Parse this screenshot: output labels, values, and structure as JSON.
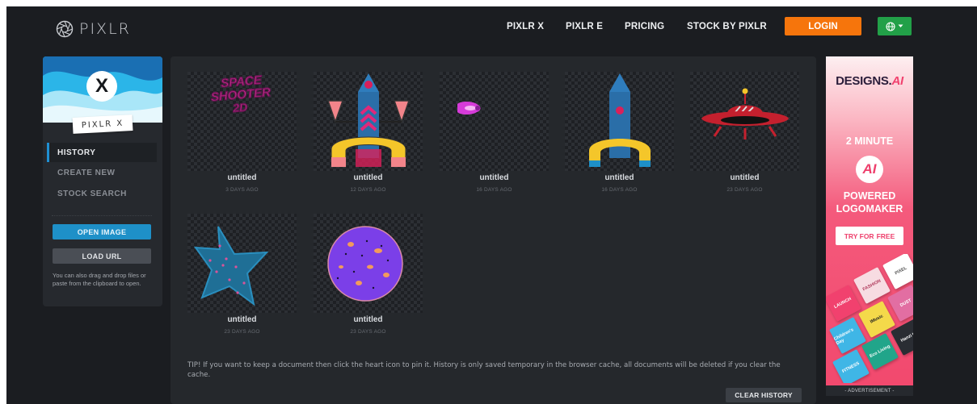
{
  "header": {
    "logo_text": "PIXLR",
    "nav": [
      "PIXLR X",
      "PIXLR E",
      "PRICING",
      "STOCK BY PIXLR"
    ],
    "login_label": "LOGIN",
    "language_icon": "globe-icon"
  },
  "sidebar": {
    "brand_letter": "X",
    "brand_label": "PIXLR X",
    "menu": [
      {
        "label": "HISTORY",
        "active": true
      },
      {
        "label": "CREATE NEW",
        "active": false
      },
      {
        "label": "STOCK SEARCH",
        "active": false
      }
    ],
    "open_image_label": "OPEN IMAGE",
    "load_url_label": "LOAD URL",
    "hint": "You can also drag and drop files or paste from the clipboard to open."
  },
  "history": {
    "items": [
      {
        "title": "untitled",
        "date": "3 DAYS AGO",
        "image": "space-shooter-title",
        "image_text": [
          "SPACE",
          "SHOOTER",
          "2D"
        ]
      },
      {
        "title": "untitled",
        "date": "12 DAYS AGO",
        "image": "rocket-with-side-cones"
      },
      {
        "title": "untitled",
        "date": "16 DAYS AGO",
        "image": "pink-bullet"
      },
      {
        "title": "untitled",
        "date": "16 DAYS AGO",
        "image": "rocket"
      },
      {
        "title": "untitled",
        "date": "23 DAYS AGO",
        "image": "ufo"
      },
      {
        "title": "untitled",
        "date": "23 DAYS AGO",
        "image": "blue-star"
      },
      {
        "title": "untitled",
        "date": "23 DAYS AGO",
        "image": "purple-planet"
      }
    ],
    "tip": "TIP! If you want to keep a document then click the heart icon to pin it. History is only saved temporary in the browser cache, all documents will be deleted if you clear the cache.",
    "clear_label": "CLEAR HISTORY"
  },
  "ad": {
    "brand": "DESIGNS.",
    "brand_accent": "AI",
    "line1": "2 MINUTE",
    "icon_letter": "AI",
    "line2": "POWERED",
    "line3": "LOGOMAKER",
    "cta": "TRY FOR",
    "cta_accent": "FREE",
    "tiles": [
      "LAUNCH",
      "FASHION",
      "PIXEL",
      "IMusic",
      "DUST",
      "Children's Day",
      "Eco Living",
      "FITNESS",
      "Hanzi IO"
    ],
    "footer": "- ADVERTISEMENT -"
  },
  "colors": {
    "background": "#1b1d21",
    "panel": "#25282c",
    "login": "#f6750c",
    "language": "#22a048",
    "primary_button": "#1e90c8",
    "ad_accent": "#f1416e"
  }
}
